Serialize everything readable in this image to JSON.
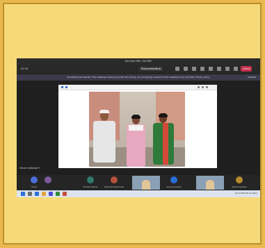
{
  "window": {
    "title": "हेल्थ हे प्रेक्षक मीटिंग / टीम्स मीटिंग"
  },
  "toolbar": {
    "timer": "41:18",
    "stop_presenting_label": "Stop presenting",
    "leave_label": "Leave",
    "leave_color": "#c4314b"
  },
  "banner": {
    "text": "Something has started. The meeting is being recorded. By joining, you are giving consent for this meeting to be recorded. Privacy policy",
    "dismiss_label": "Dismiss"
  },
  "presenter": {
    "label": "Vinod Gaikwad ✎"
  },
  "participants": [
    {
      "name": "Vinod",
      "color": "#4a6fd6"
    },
    {
      "name": "",
      "color": "#7a5a9a"
    },
    {
      "name": "Shrikant Pawar",
      "color": "#2f7a6a"
    },
    {
      "name": "Sharmila Deshmukh",
      "color": "#b5503a"
    },
    {
      "name": "",
      "color": "#666"
    },
    {
      "name": "Sarvesh Jadhav",
      "color": "#2a6fd6"
    },
    {
      "name": "Santosh Jadhav",
      "color": "#b58a2a"
    },
    {
      "name": "",
      "color": "#7a7a7a"
    }
  ],
  "taskbar": {
    "time": "12:41 PM",
    "date": "29-11-2021"
  }
}
